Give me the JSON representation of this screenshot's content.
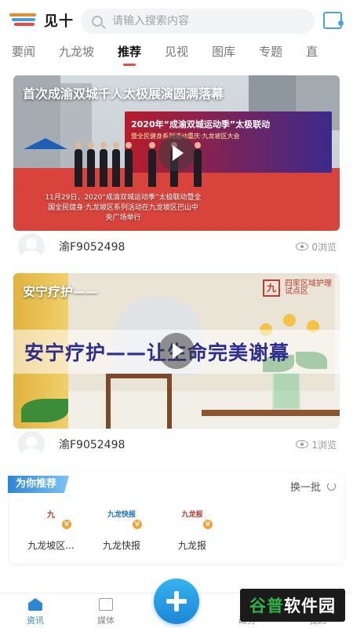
{
  "header": {
    "logo_text": "见十",
    "search_placeholder": "请输入搜索内容"
  },
  "tabs": [
    {
      "label": "要闻"
    },
    {
      "label": "九龙坡"
    },
    {
      "label": "推荐",
      "active": true
    },
    {
      "label": "见视"
    },
    {
      "label": "图库"
    },
    {
      "label": "专题"
    },
    {
      "label": "直"
    }
  ],
  "feed": [
    {
      "title": "首次成渝双城千人太极展演圆满落幕",
      "banner_title": "2020年“成渝双城运动季”太极联动",
      "banner_sub": "暨全民健身系列活动重庆·九龙坡区大会",
      "caption": "11月29日，2020“成渝双城运动季”太极联动暨全国全民健身·九龙坡区系列活动在九龙坡区巴山中央广场举行",
      "author": "渝F9052498",
      "views": "0浏览"
    },
    {
      "title": "安宁疗护——",
      "headline": "安宁疗护——让生命完美谢幕",
      "tag_mark": "九",
      "tag_text": "四家区域护理 试点区",
      "author": "渝F9052498",
      "views": "1浏览"
    }
  ],
  "recommend": {
    "title": "为你推荐",
    "refresh": "换一批",
    "items": [
      {
        "name": "九龙坡区...",
        "logo": "九",
        "logo_color": "#c0392b"
      },
      {
        "name": "九龙快报",
        "logo": "九龙快报",
        "logo_color": "#1c6fc2"
      },
      {
        "name": "九龙报",
        "logo": "九龙报",
        "logo_color": "#c0392b"
      }
    ],
    "badge": "V"
  },
  "bottombar": {
    "items": [
      {
        "label": "资讯",
        "active": true
      },
      {
        "label": "媒体"
      },
      {
        "label": ""
      },
      {
        "label": "政务"
      },
      {
        "label": "我的"
      }
    ]
  },
  "watermark": {
    "part1": "谷普",
    "part2": "软件园"
  },
  "colors": {
    "accent": "#2f86d6",
    "tab_indicator": "#e84c3d"
  }
}
